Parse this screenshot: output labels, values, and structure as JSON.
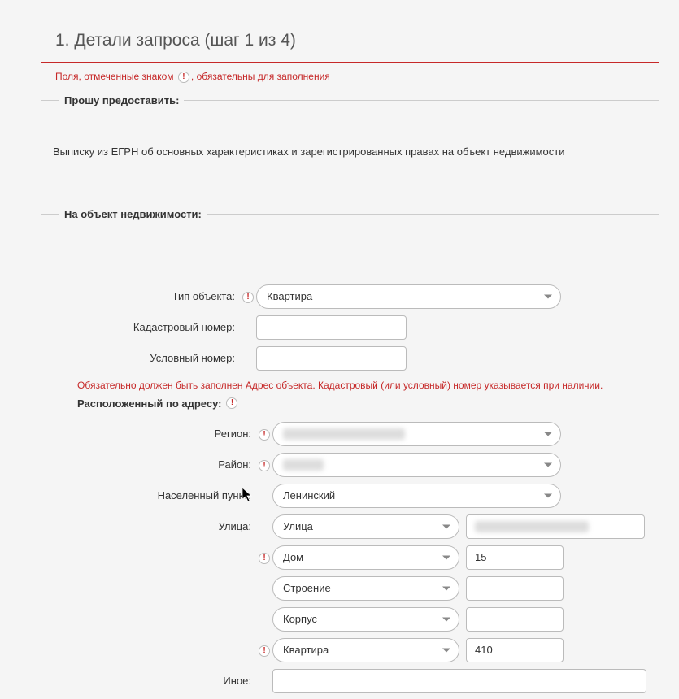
{
  "page": {
    "title": "1. Детали запроса (шаг 1 из 4)",
    "required_note_before": "Поля, отмеченные знаком",
    "required_note_after": ", обязательны для заполнения"
  },
  "provide": {
    "legend": "Прошу предоставить:",
    "text": "Выписку из ЕГРН об основных характеристиках и зарегистрированных правах на объект недвижимости"
  },
  "object": {
    "legend": "На объект недвижимости:",
    "type_label": "Тип объекта:",
    "type_value": "Квартира",
    "cad_label": "Кадастровый номер:",
    "cad_value": "",
    "cond_label": "Условный номер:",
    "cond_value": "",
    "warn": "Обязательно должен быть заполнен Адрес объекта. Кадастровый (или условный) номер указывается при наличии.",
    "address_label": "Расположенный по адресу:"
  },
  "address": {
    "region_label": "Регион:",
    "region_value": "",
    "district_label": "Район:",
    "district_value": "",
    "settlement_label": "Населенный пункт:",
    "settlement_value": "Ленинский",
    "street_label": "Улица:",
    "street_type": "Улица",
    "street_value": "",
    "house_type": "Дом",
    "house_value": "15",
    "building_type": "Строение",
    "building_value": "",
    "korpus_type": "Корпус",
    "korpus_value": "",
    "apt_type": "Квартира",
    "apt_value": "410",
    "other_label": "Иное:",
    "other_value": ""
  },
  "req_marker": "!"
}
